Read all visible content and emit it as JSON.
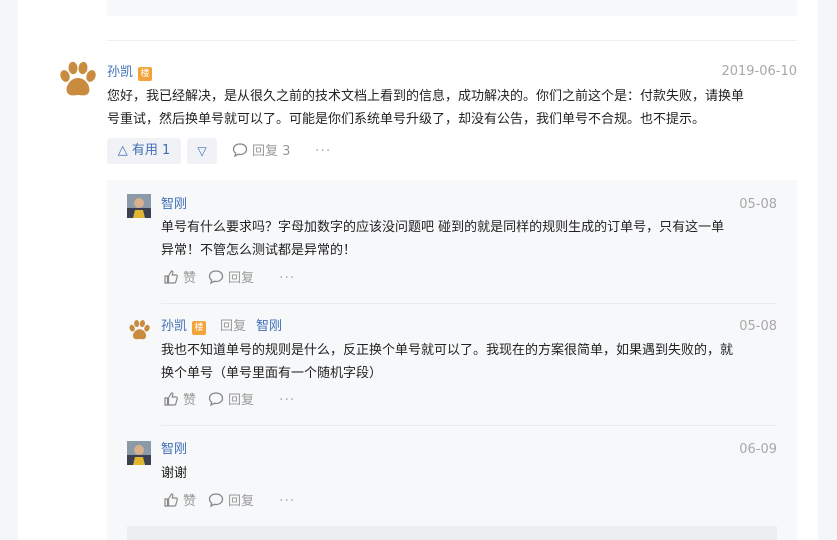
{
  "main_comment": {
    "author": "孙凯",
    "badge": "楼",
    "date": "2019-06-10",
    "text_line1": "您好，我已经解决，是从很久之前的技术文档上看到的信息，成功解决的。你们之前这个是：付款失败，请换单",
    "text_line2": "号重试，然后换单号就可以了。可能是你们系统单号升级了，却没有公告，我们单号不合规。也不提示。",
    "useful_label": "△ 有用 1",
    "down_label": "▽",
    "reply_label": "回复 3",
    "more": "···"
  },
  "replies": [
    {
      "author": "智刚",
      "date": "05-08",
      "text_line1": "单号有什么要求吗？字母加数字的应该没问题吧 碰到的就是同样的规则生成的订单号，只有这一单",
      "text_line2": "异常！不管怎么测试都是异常的！",
      "like_label": "赞",
      "reply_label": "回复",
      "more": "···"
    },
    {
      "author": "孙凯",
      "badge": "楼",
      "reply_to_label": "回复",
      "reply_to": "智刚",
      "date": "05-08",
      "text_line1": "我也不知道单号的规则是什么，反正换个单号就可以了。我现在的方案很简单，如果遇到失败的，就",
      "text_line2": "换个单号（单号里面有一个随机字段）",
      "like_label": "赞",
      "reply_label": "回复",
      "more": "···"
    },
    {
      "author": "智刚",
      "date": "06-09",
      "text_line1": "谢谢",
      "like_label": "赞",
      "reply_label": "回复",
      "more": "···"
    }
  ],
  "colors": {
    "link": "#3f6fb5",
    "badge": "#f2a33a",
    "muted": "#999999",
    "reply_bg": "#f7f8fa",
    "paw": "#c98b3e"
  }
}
